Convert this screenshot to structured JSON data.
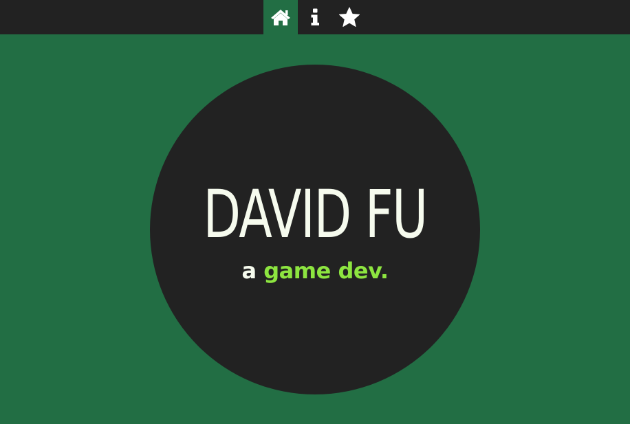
{
  "nav": {
    "items": [
      {
        "icon": "home-icon",
        "active": true
      },
      {
        "icon": "info-icon",
        "active": false
      },
      {
        "icon": "star-icon",
        "active": false
      }
    ]
  },
  "hero": {
    "name": "DAVID FU",
    "tagline_prefix": "a",
    "tagline_accent": "game dev."
  },
  "colors": {
    "background": "#226e44",
    "bar": "#222222",
    "circle": "#222222",
    "text": "#f6fbee",
    "accent": "#8de540"
  }
}
